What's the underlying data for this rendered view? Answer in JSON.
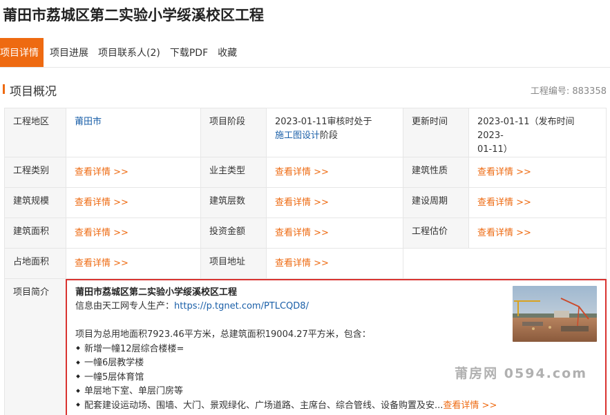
{
  "page": {
    "title": "莆田市荔城区第二实验小学绥溪校区工程"
  },
  "tabs": [
    {
      "label": "项目详情",
      "active": true
    },
    {
      "label": "项目进展"
    },
    {
      "label": "项目联系人(2)"
    },
    {
      "label": "下载PDF"
    },
    {
      "label": "收藏"
    }
  ],
  "section": {
    "title": "项目概况",
    "project_no_label": "工程编号:",
    "project_no": "883358"
  },
  "info": {
    "region_label": "工程地区",
    "region_value": "莆田市",
    "stage_label": "项目阶段",
    "stage_prefix": "2023-01-11审核时处于",
    "stage_link": "施工图设计",
    "stage_suffix": "阶段",
    "update_label": "更新时间",
    "update_value_line1": "2023-01-11（发布时间2023-",
    "update_value_line2": "01-11）",
    "category_label": "工程类别",
    "owner_type_label": "业主类型",
    "nature_label": "建筑性质",
    "scale_label": "建筑规模",
    "floors_label": "建筑层数",
    "period_label": "建设周期",
    "area_label": "建筑面积",
    "investment_label": "投资金额",
    "estimate_label": "工程估价",
    "land_area_label": "占地面积",
    "address_label": "项目地址",
    "more_link": "查看详情 >>"
  },
  "intro": {
    "label": "项目简介",
    "title": "莆田市荔城区第二实验小学绥溪校区工程",
    "source_prefix": "信息由天工网专人生产：",
    "source_link": "https://p.tgnet.com/PTLCQD8/",
    "summary": "项目为总用地面积7923.46平方米，总建筑面积19004.27平方米，包含：",
    "items": [
      "新增一幢12层综合楼楼=",
      "一幢6层教学楼",
      "一幢5层体育馆",
      "单层地下室、单层门房等"
    ],
    "last_item": "配套建设运动场、围墙、大门、景观绿化、广场道路、主席台、综合管线、设备购置及安",
    "ellipsis": "...",
    "more": "查看详情 >>"
  },
  "watermark": "莆房网 0594.com",
  "colors": {
    "accent": "#ee6a11",
    "link": "#1a5fa8",
    "highlight_border": "#d9322f"
  }
}
